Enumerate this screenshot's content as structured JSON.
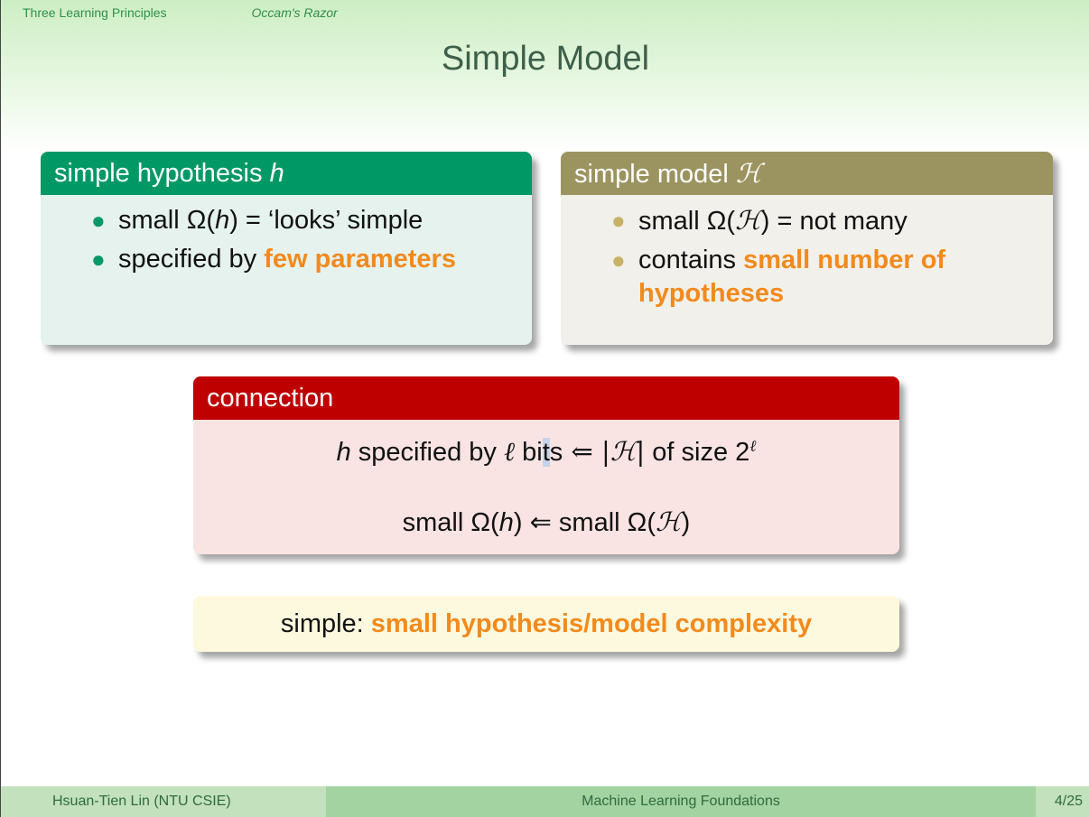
{
  "nav": {
    "section": "Three Learning Principles",
    "subsection": "Occam's Razor"
  },
  "title": "Simple Model",
  "block_hypothesis": {
    "title_prefix": "simple hypothesis ",
    "title_symbol": "h",
    "items": [
      {
        "pre": "small Ω(",
        "sym": "h",
        "post": ") = ‘looks’ simple"
      },
      {
        "pre": "specified by ",
        "em": "few parameters"
      }
    ]
  },
  "block_model": {
    "title_prefix": "simple model ",
    "title_symbol": "ℋ",
    "items": [
      {
        "pre": "small Ω(",
        "sym": "ℋ",
        "post": ") = not many"
      },
      {
        "pre": "contains ",
        "em": "small number of hypotheses"
      }
    ]
  },
  "block_connection": {
    "title": "connection",
    "line1": {
      "h": "h",
      "mid": " specified by ",
      "ell": "ℓ",
      "bi": " bi",
      "hl": "t",
      "s": "s",
      "arrow": " ⇐ ",
      "card": "|ℋ|",
      "tail": " of size 2",
      "exp": "ℓ"
    },
    "line2": {
      "a": "small Ω(",
      "h": "h",
      "b": ") ⇐ small Ω(",
      "H": "ℋ",
      "c": ")"
    }
  },
  "summary": {
    "pre": "simple: ",
    "em": "small hypothesis/model complexity"
  },
  "footer": {
    "author": "Hsuan-Tien Lin (NTU CSIE)",
    "course": "Machine Learning Foundations",
    "page": "4/25"
  },
  "colors": {
    "hypothesis_header": "#009966",
    "model_header": "#9c9460",
    "connection_header": "#bf0000",
    "emphasis": "#f28a1c"
  }
}
